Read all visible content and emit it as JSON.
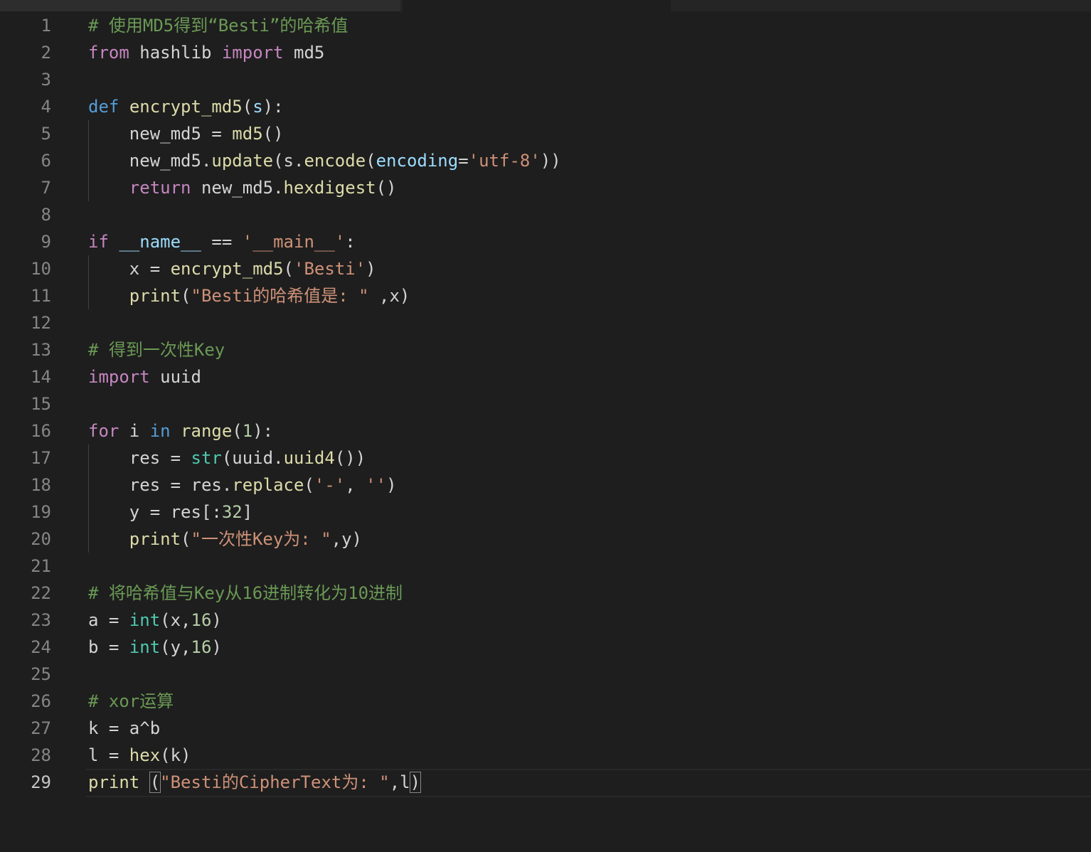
{
  "editor": {
    "active_line": 29,
    "colors": {
      "background": "#1e1e1e",
      "keyword_control": "#c586c0",
      "keyword": "#569cd6",
      "function": "#dcdcaa",
      "string": "#ce9178",
      "comment": "#6a9955",
      "number": "#b5cea8",
      "parameter": "#9cdcfe",
      "builtin_type": "#4ec9b0",
      "text": "#d4d4d4",
      "line_number": "#858585"
    },
    "lines": [
      {
        "n": "1",
        "tokens": [
          {
            "t": "# 使用MD5得到“Besti”的哈希值",
            "c": "cmt"
          }
        ]
      },
      {
        "n": "2",
        "tokens": [
          {
            "t": "from",
            "c": "kw-ctrl"
          },
          {
            "t": " hashlib ",
            "c": "plain"
          },
          {
            "t": "import",
            "c": "kw-ctrl"
          },
          {
            "t": " md5",
            "c": "plain"
          }
        ]
      },
      {
        "n": "3",
        "tokens": []
      },
      {
        "n": "4",
        "tokens": [
          {
            "t": "def",
            "c": "kw"
          },
          {
            "t": " ",
            "c": "plain"
          },
          {
            "t": "encrypt_md5",
            "c": "fn"
          },
          {
            "t": "(",
            "c": "plain"
          },
          {
            "t": "s",
            "c": "param"
          },
          {
            "t": "):",
            "c": "plain"
          }
        ]
      },
      {
        "n": "5",
        "tokens": [
          {
            "t": "    new_md5 = ",
            "c": "plain"
          },
          {
            "t": "md5",
            "c": "fn"
          },
          {
            "t": "()",
            "c": "plain"
          }
        ]
      },
      {
        "n": "6",
        "tokens": [
          {
            "t": "    new_md5.",
            "c": "plain"
          },
          {
            "t": "update",
            "c": "fn"
          },
          {
            "t": "(s.",
            "c": "plain"
          },
          {
            "t": "encode",
            "c": "fn"
          },
          {
            "t": "(",
            "c": "plain"
          },
          {
            "t": "encoding",
            "c": "param"
          },
          {
            "t": "=",
            "c": "plain"
          },
          {
            "t": "'utf-8'",
            "c": "str"
          },
          {
            "t": "))",
            "c": "plain"
          }
        ]
      },
      {
        "n": "7",
        "tokens": [
          {
            "t": "    ",
            "c": "plain"
          },
          {
            "t": "return",
            "c": "kw-ctrl"
          },
          {
            "t": " new_md5.",
            "c": "plain"
          },
          {
            "t": "hexdigest",
            "c": "fn"
          },
          {
            "t": "()",
            "c": "plain"
          }
        ]
      },
      {
        "n": "8",
        "tokens": []
      },
      {
        "n": "9",
        "tokens": [
          {
            "t": "if",
            "c": "kw-ctrl"
          },
          {
            "t": " ",
            "c": "plain"
          },
          {
            "t": "__name__",
            "c": "param"
          },
          {
            "t": " == ",
            "c": "plain"
          },
          {
            "t": "'__main__'",
            "c": "str"
          },
          {
            "t": ":",
            "c": "plain"
          }
        ]
      },
      {
        "n": "10",
        "tokens": [
          {
            "t": "    x = ",
            "c": "plain"
          },
          {
            "t": "encrypt_md5",
            "c": "fn"
          },
          {
            "t": "(",
            "c": "plain"
          },
          {
            "t": "'Besti'",
            "c": "str"
          },
          {
            "t": ")",
            "c": "plain"
          }
        ]
      },
      {
        "n": "11",
        "tokens": [
          {
            "t": "    ",
            "c": "plain"
          },
          {
            "t": "print",
            "c": "fn"
          },
          {
            "t": "(",
            "c": "plain"
          },
          {
            "t": "\"Besti的哈希值是: \"",
            "c": "str"
          },
          {
            "t": " ,x)",
            "c": "plain"
          }
        ]
      },
      {
        "n": "12",
        "tokens": []
      },
      {
        "n": "13",
        "tokens": [
          {
            "t": "# 得到一次性Key",
            "c": "cmt"
          }
        ]
      },
      {
        "n": "14",
        "tokens": [
          {
            "t": "import",
            "c": "kw-ctrl"
          },
          {
            "t": " uuid",
            "c": "plain"
          }
        ]
      },
      {
        "n": "15",
        "tokens": []
      },
      {
        "n": "16",
        "tokens": [
          {
            "t": "for",
            "c": "kw-ctrl"
          },
          {
            "t": " i ",
            "c": "plain"
          },
          {
            "t": "in",
            "c": "kw"
          },
          {
            "t": " ",
            "c": "plain"
          },
          {
            "t": "range",
            "c": "fn"
          },
          {
            "t": "(",
            "c": "plain"
          },
          {
            "t": "1",
            "c": "num"
          },
          {
            "t": "):",
            "c": "plain"
          }
        ]
      },
      {
        "n": "17",
        "tokens": [
          {
            "t": "    res = ",
            "c": "plain"
          },
          {
            "t": "str",
            "c": "type"
          },
          {
            "t": "(uuid.",
            "c": "plain"
          },
          {
            "t": "uuid4",
            "c": "fn"
          },
          {
            "t": "())",
            "c": "plain"
          }
        ]
      },
      {
        "n": "18",
        "tokens": [
          {
            "t": "    res = res.",
            "c": "plain"
          },
          {
            "t": "replace",
            "c": "fn"
          },
          {
            "t": "(",
            "c": "plain"
          },
          {
            "t": "'-'",
            "c": "str"
          },
          {
            "t": ", ",
            "c": "plain"
          },
          {
            "t": "''",
            "c": "str"
          },
          {
            "t": ")",
            "c": "plain"
          }
        ]
      },
      {
        "n": "19",
        "tokens": [
          {
            "t": "    y = res[:",
            "c": "plain"
          },
          {
            "t": "32",
            "c": "num"
          },
          {
            "t": "]",
            "c": "plain"
          }
        ]
      },
      {
        "n": "20",
        "tokens": [
          {
            "t": "    ",
            "c": "plain"
          },
          {
            "t": "print",
            "c": "fn"
          },
          {
            "t": "(",
            "c": "plain"
          },
          {
            "t": "\"一次性Key为: \"",
            "c": "str"
          },
          {
            "t": ",y)",
            "c": "plain"
          }
        ]
      },
      {
        "n": "21",
        "tokens": []
      },
      {
        "n": "22",
        "tokens": [
          {
            "t": "# 将哈希值与Key从16进制转化为10进制",
            "c": "cmt"
          }
        ]
      },
      {
        "n": "23",
        "tokens": [
          {
            "t": "a = ",
            "c": "plain"
          },
          {
            "t": "int",
            "c": "type"
          },
          {
            "t": "(x,",
            "c": "plain"
          },
          {
            "t": "16",
            "c": "num"
          },
          {
            "t": ")",
            "c": "plain"
          }
        ]
      },
      {
        "n": "24",
        "tokens": [
          {
            "t": "b = ",
            "c": "plain"
          },
          {
            "t": "int",
            "c": "type"
          },
          {
            "t": "(y,",
            "c": "plain"
          },
          {
            "t": "16",
            "c": "num"
          },
          {
            "t": ")",
            "c": "plain"
          }
        ]
      },
      {
        "n": "25",
        "tokens": []
      },
      {
        "n": "26",
        "tokens": [
          {
            "t": "# xor运算",
            "c": "cmt"
          }
        ]
      },
      {
        "n": "27",
        "tokens": [
          {
            "t": "k = a^b",
            "c": "plain"
          }
        ]
      },
      {
        "n": "28",
        "tokens": [
          {
            "t": "l = ",
            "c": "plain"
          },
          {
            "t": "hex",
            "c": "fn"
          },
          {
            "t": "(k)",
            "c": "plain"
          }
        ]
      },
      {
        "n": "29",
        "tokens": [
          {
            "t": "print",
            "c": "fn"
          },
          {
            "t": " ",
            "c": "plain"
          },
          {
            "t": "(",
            "c": "plain",
            "box": true
          },
          {
            "t": "\"Besti的CipherText为: \"",
            "c": "str"
          },
          {
            "t": ",l",
            "c": "plain"
          },
          {
            "t": ")",
            "c": "plain",
            "box": true
          }
        ]
      }
    ]
  }
}
